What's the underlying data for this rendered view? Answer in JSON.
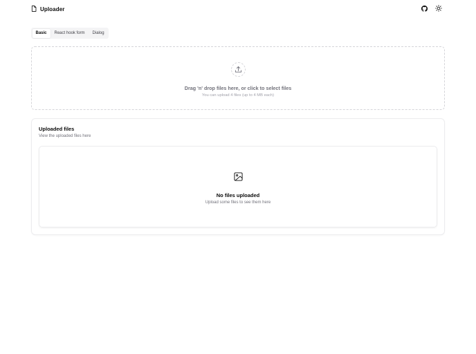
{
  "header": {
    "title": "Uploader",
    "logo_icon": "file-icon",
    "actions": [
      {
        "name": "github-icon"
      },
      {
        "name": "sun-icon"
      }
    ]
  },
  "tabs": [
    {
      "label": "Basic",
      "active": true
    },
    {
      "label": "React hook form",
      "active": false
    },
    {
      "label": "Dialog",
      "active": false
    }
  ],
  "dropzone": {
    "icon": "upload-icon",
    "title": "Drag 'n' drop files here, or click to select files",
    "subtitle": "You can upload 4 files (up to 4 MB each)"
  },
  "uploaded_card": {
    "title": "Uploaded files",
    "description": "View the uploaded files here",
    "empty": {
      "icon": "image-icon",
      "title": "No files uploaded",
      "subtitle": "Upload some files to see them here"
    }
  },
  "colors": {
    "text": "#0a0a0a",
    "muted": "#71717a",
    "border": "#e4e4e7",
    "tab_bg": "#f4f4f5"
  }
}
